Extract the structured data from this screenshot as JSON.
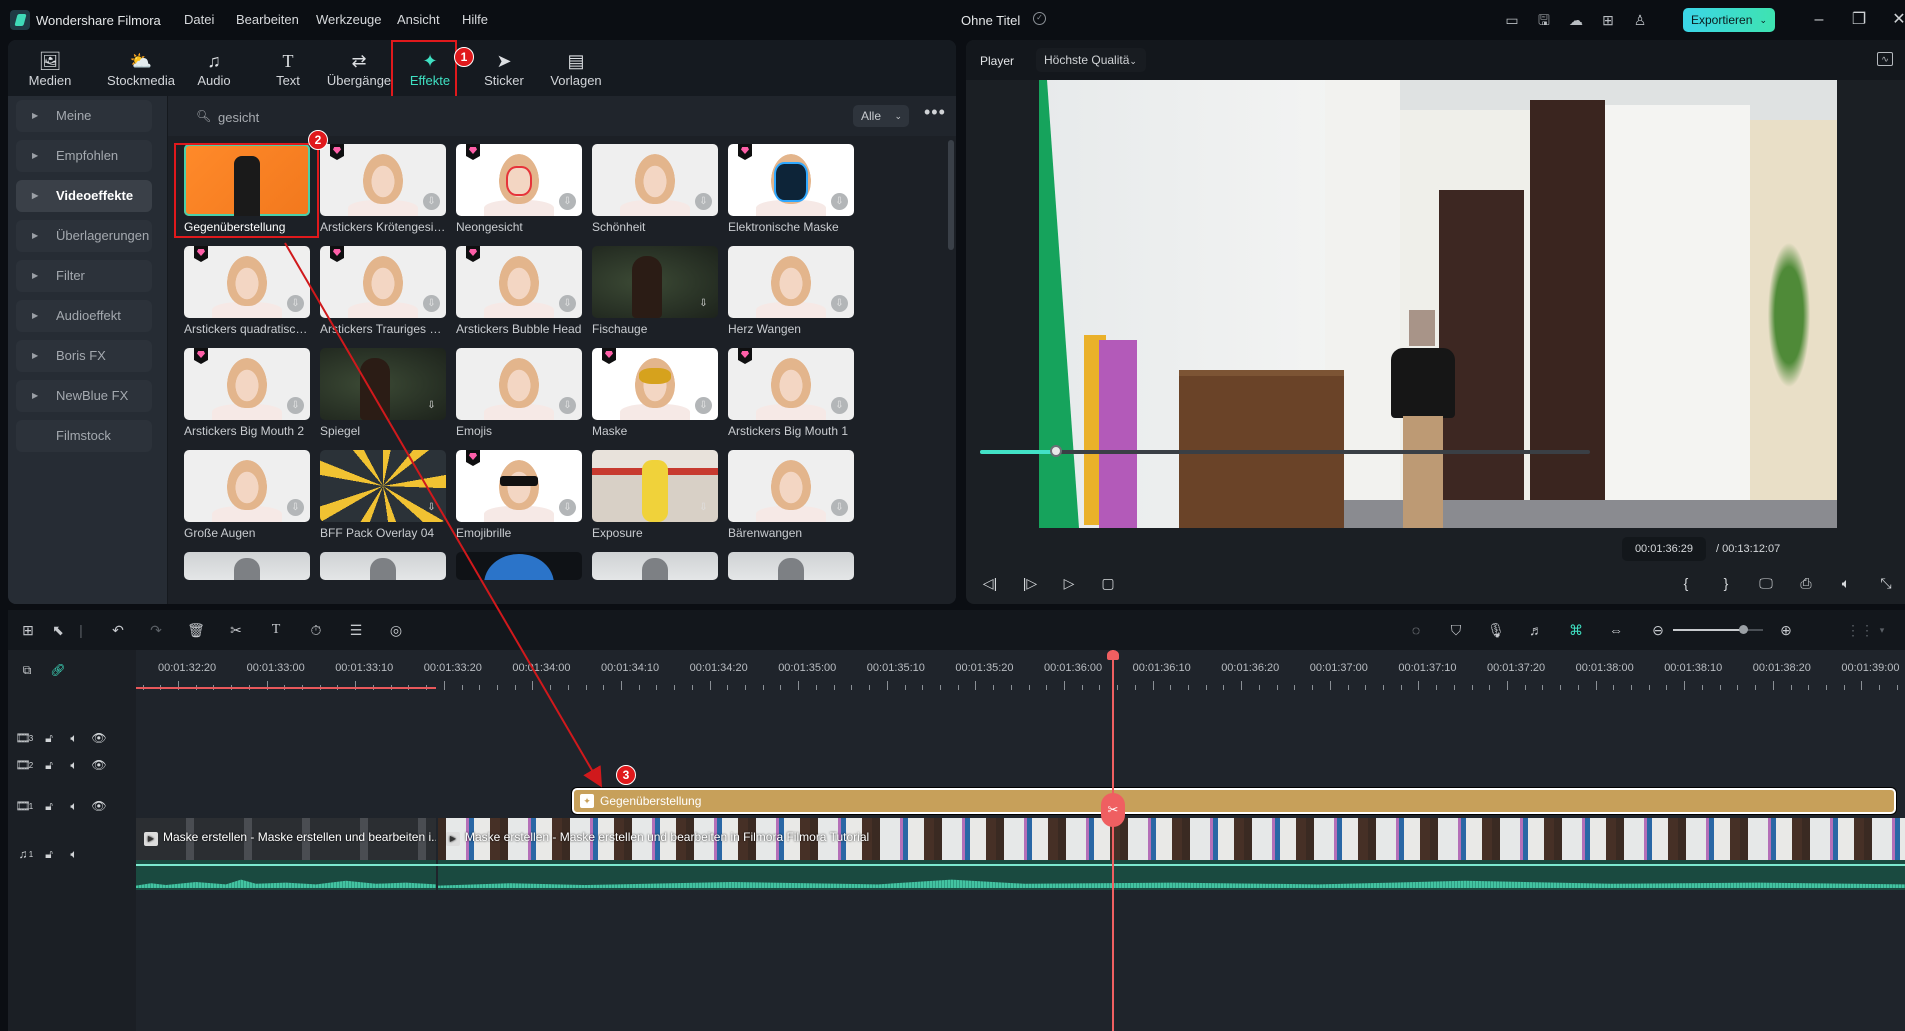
{
  "titlebar": {
    "app_name": "Wondershare Filmora",
    "menus": [
      "Datei",
      "Bearbeiten",
      "Werkzeuge",
      "Ansicht",
      "Hilfe"
    ],
    "project_title": "Ohne Titel",
    "export_label": "Exportieren",
    "right_icons": [
      "layout-icon",
      "save-icon",
      "cloud-upload-icon",
      "apps-grid-icon",
      "account-icon"
    ],
    "window_controls": [
      "minimize-icon",
      "restore-icon",
      "close-icon"
    ]
  },
  "media_tabs": [
    {
      "label": "Medien",
      "icon": "media-icon"
    },
    {
      "label": "Stockmedia",
      "icon": "stock-media-icon"
    },
    {
      "label": "Audio",
      "icon": "music-note-icon"
    },
    {
      "label": "Text",
      "icon": "text-icon"
    },
    {
      "label": "Übergänge",
      "icon": "transition-icon"
    },
    {
      "label": "Effekte",
      "icon": "effects-wand-icon",
      "active": true
    },
    {
      "label": "Sticker",
      "icon": "sticker-icon"
    },
    {
      "label": "Vorlagen",
      "icon": "templates-icon"
    }
  ],
  "annotations": {
    "badge1": "1",
    "badge2": "2",
    "badge3": "3"
  },
  "sidebar": {
    "items": [
      {
        "label": "Meine",
        "expandable": true
      },
      {
        "label": "Empfohlen",
        "expandable": true
      },
      {
        "label": "Videoeffekte",
        "expandable": true,
        "active": true
      },
      {
        "label": "Überlagerungen",
        "expandable": true
      },
      {
        "label": "Filter",
        "expandable": true
      },
      {
        "label": "Audioeffekt",
        "expandable": true
      },
      {
        "label": "Boris FX",
        "expandable": true
      },
      {
        "label": "NewBlue FX",
        "expandable": true
      },
      {
        "label": "Filmstock",
        "expandable": false
      }
    ]
  },
  "search": {
    "value": "gesicht",
    "filter_value": "Alle"
  },
  "effects": [
    {
      "name": "Gegenüberstellung",
      "premium": false,
      "selected": true,
      "style": "orange"
    },
    {
      "name": "Arstickers Krötengesicht",
      "premium": true,
      "style": "face"
    },
    {
      "name": "Neongesicht",
      "premium": true,
      "style": "face-neon"
    },
    {
      "name": "Schönheit",
      "premium": false,
      "style": "face"
    },
    {
      "name": "Elektronische Maske",
      "premium": true,
      "style": "face-mask-blue"
    },
    {
      "name": "Arstickers quadratisch...",
      "premium": true,
      "style": "face"
    },
    {
      "name": "Arstickers Trauriges Ge...",
      "premium": true,
      "style": "face"
    },
    {
      "name": "Arstickers Bubble Head",
      "premium": true,
      "style": "face"
    },
    {
      "name": "Fischauge",
      "premium": false,
      "style": "dark-portrait"
    },
    {
      "name": "Herz Wangen",
      "premium": false,
      "style": "face"
    },
    {
      "name": "Arstickers Big Mouth 2",
      "premium": true,
      "style": "face"
    },
    {
      "name": "Spiegel",
      "premium": false,
      "style": "dark-portrait"
    },
    {
      "name": "Emojis",
      "premium": false,
      "style": "face"
    },
    {
      "name": "Maske",
      "premium": true,
      "style": "face-gold-mask"
    },
    {
      "name": "Arstickers Big Mouth 1",
      "premium": true,
      "style": "face"
    },
    {
      "name": "Große Augen",
      "premium": false,
      "style": "face"
    },
    {
      "name": "BFF Pack Overlay 04",
      "premium": false,
      "style": "burst"
    },
    {
      "name": "Emojibrille",
      "premium": true,
      "style": "face-glasses"
    },
    {
      "name": "Exposure",
      "premium": false,
      "style": "exposure"
    },
    {
      "name": "Bärenwangen",
      "premium": false,
      "style": "face"
    },
    {
      "name": "",
      "premium": false,
      "style": "grey"
    },
    {
      "name": "",
      "premium": false,
      "style": "grey"
    },
    {
      "name": "",
      "premium": false,
      "style": "blue-circle"
    },
    {
      "name": "",
      "premium": false,
      "style": "grey"
    },
    {
      "name": "",
      "premium": false,
      "style": "grey"
    }
  ],
  "player": {
    "label": "Player",
    "quality": "Höchste Qualitä",
    "current_time": "00:01:36:29",
    "total_time": "/ 00:13:12:07",
    "progress_fraction": 0.125,
    "controls_left": [
      "prev-frame-icon",
      "next-frame-icon",
      "play-icon",
      "stop-icon"
    ],
    "controls_right": [
      "mark-in-icon",
      "mark-out-icon",
      "display-settings-icon",
      "snapshot-icon",
      "volume-icon",
      "fullscreen-icon"
    ],
    "mark_in_glyph": "{",
    "mark_out_glyph": "}"
  },
  "timeline": {
    "toolbar_left": [
      "layout-grid-icon",
      "select-tool-icon",
      "undo-icon",
      "redo-icon",
      "delete-icon",
      "split-icon",
      "text-tool-icon",
      "speed-icon",
      "adjust-icon",
      "audio-stretch-icon"
    ],
    "toolbar_right": [
      "render-preview-icon",
      "marker-icon",
      "voiceover-icon",
      "audio-mix-icon",
      "snap-icon",
      "fit-icon",
      "zoom-out-icon",
      "zoom-in-icon",
      "track-options-icon"
    ],
    "zoom_level_fraction": 0.8,
    "ruler_labels": [
      "00:01:32:20",
      "00:01:33:00",
      "00:01:33:10",
      "00:01:33:20",
      "00:01:34:00",
      "00:01:34:10",
      "00:01:34:20",
      "00:01:35:00",
      "00:01:35:10",
      "00:01:35:20",
      "00:01:36:00",
      "00:01:36:10",
      "00:01:36:20",
      "00:01:37:00",
      "00:01:37:10",
      "00:01:37:20",
      "00:01:38:00",
      "00:01:38:10",
      "00:01:38:20",
      "00:01:39:00"
    ],
    "tracks": [
      {
        "name": "video-track-3",
        "number": "3",
        "type": "video"
      },
      {
        "name": "video-track-2",
        "number": "2",
        "type": "video"
      },
      {
        "name": "video-track-1",
        "number": "1",
        "type": "video"
      },
      {
        "name": "audio-track-1",
        "number": "1",
        "type": "audio"
      }
    ],
    "effect_clip_label": "Gegenüberstellung",
    "video_clip_1_label": "Maske erstellen - Maske erstellen und bearbeiten i...",
    "video_clip_2_label": "Maske erstellen - Maske erstellen und bearbeiten in Filmora  Filmora Tutorial"
  }
}
